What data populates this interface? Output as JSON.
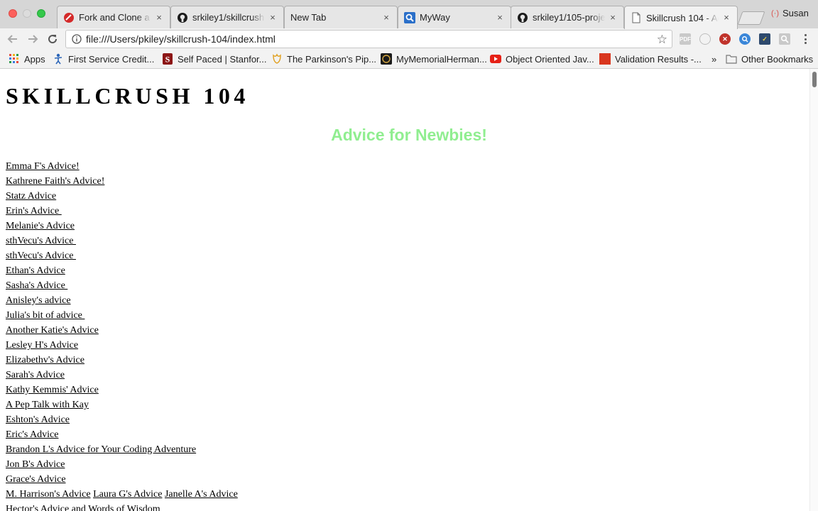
{
  "browser": {
    "tabs": [
      {
        "title": "Fork and Clone a S",
        "icon": "red-circle-icon",
        "active": false
      },
      {
        "title": "srkiley1/skillcrush-",
        "icon": "github-icon",
        "active": false
      },
      {
        "title": "New Tab",
        "icon": "",
        "active": false
      },
      {
        "title": "MyWay",
        "icon": "search-icon",
        "active": false
      },
      {
        "title": "srkiley1/105-proje",
        "icon": "github-icon",
        "active": false
      },
      {
        "title": "Skillcrush 104 - Ad",
        "icon": "document-icon",
        "active": true
      }
    ],
    "close_glyph": "×",
    "profile_name": "Susan",
    "url": "file:///Users/pkiley/skillcrush-104/index.html",
    "star_glyph": "☆",
    "extensions": {
      "pdf_label": "PDF"
    },
    "bookmarks": [
      {
        "label": "Apps",
        "icon": "apps-grid-icon"
      },
      {
        "label": "First Service Credit...",
        "icon": "person-icon"
      },
      {
        "label": "Self Paced | Stanfor...",
        "icon": "stanford-s-icon"
      },
      {
        "label": "The Parkinson's Pip...",
        "icon": "tulip-icon"
      },
      {
        "label": "MyMemorialHerman...",
        "icon": "memorial-hermann-icon"
      },
      {
        "label": "Object Oriented Jav...",
        "icon": "youtube-icon"
      },
      {
        "label": "Validation Results -...",
        "icon": "red-square-icon"
      }
    ],
    "bookmarks_overflow": "»",
    "other_bookmarks": "Other Bookmarks",
    "colors": {
      "tab_strip": "#d6d6d6",
      "toolbar": "#f2f2f2",
      "subtitle": "#90ee90"
    }
  },
  "page": {
    "title": "SKILLCRUSH 104",
    "subtitle": "Advice for Newbies!",
    "links": [
      [
        "Emma F's Advice!"
      ],
      [
        "Kathrene Faith's Advice!"
      ],
      [
        "Statz Advice"
      ],
      [
        "Erin's Advice "
      ],
      [
        "Melanie's Advice"
      ],
      [
        "sthVecu's Advice "
      ],
      [
        "sthVecu's Advice "
      ],
      [
        "Ethan's Advice"
      ],
      [
        "Sasha's Advice "
      ],
      [
        "Anisley's advice"
      ],
      [
        "Julia's bit of advice "
      ],
      [
        "Another Katie's Advice"
      ],
      [
        "Lesley H's Advice"
      ],
      [
        "Elizabethv's Advice"
      ],
      [
        "Sarah's Advice"
      ],
      [
        "Kathy Kemmis' Advice"
      ],
      [
        "A Pep Talk with Kay"
      ],
      [
        "Eshton's Advice"
      ],
      [
        "Eric's Advice"
      ],
      [
        "Brandon L's Advice for Your Coding Adventure"
      ],
      [
        "Jon B's Advice"
      ],
      [
        "Grace's Advice"
      ],
      [
        "M. Harrison's Advice",
        "Laura G's Advice",
        "Janelle A's Advice"
      ],
      [
        "Hector's Advice and Words of Wisdom"
      ]
    ]
  }
}
